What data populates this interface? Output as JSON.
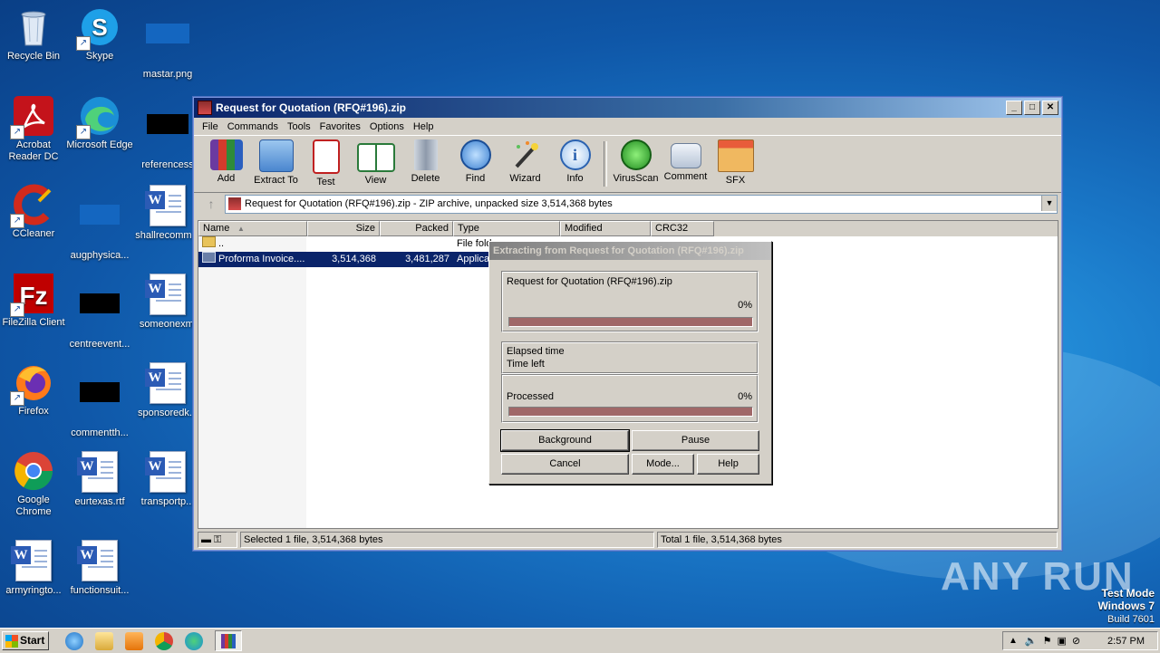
{
  "desktop": {
    "icons": [
      {
        "label": "Recycle Bin"
      },
      {
        "label": "Skype"
      },
      {
        "label": "mastar.png"
      },
      {
        "label": "Acrobat Reader DC"
      },
      {
        "label": "Microsoft Edge"
      },
      {
        "label": "referencess"
      },
      {
        "label": "CCleaner"
      },
      {
        "label": "augphysica..."
      },
      {
        "label": "shallrecomm..."
      },
      {
        "label": "FileZilla Client"
      },
      {
        "label": "centreevent..."
      },
      {
        "label": "someonexml"
      },
      {
        "label": "Firefox"
      },
      {
        "label": "commentth..."
      },
      {
        "label": "sponsoredk..."
      },
      {
        "label": "Google Chrome"
      },
      {
        "label": "eurtexas.rtf"
      },
      {
        "label": "transportp..."
      },
      {
        "label": "armyringto..."
      },
      {
        "label": "functionsuit..."
      }
    ]
  },
  "window": {
    "title": "Request for Quotation (RFQ#196).zip",
    "menu": [
      "File",
      "Commands",
      "Tools",
      "Favorites",
      "Options",
      "Help"
    ],
    "toolbar": [
      "Add",
      "Extract To",
      "Test",
      "View",
      "Delete",
      "Find",
      "Wizard",
      "Info",
      "VirusScan",
      "Comment",
      "SFX"
    ],
    "address": "Request for Quotation (RFQ#196).zip - ZIP archive, unpacked size 3,514,368 bytes",
    "columns": [
      "Name",
      "Size",
      "Packed",
      "Type",
      "Modified",
      "CRC32"
    ],
    "rows": [
      {
        "name": "..",
        "size": "",
        "packed": "",
        "type": "File fold"
      },
      {
        "name": "Proforma Invoice....",
        "size": "3,514,368",
        "packed": "3,481,287",
        "type": "Applicat"
      }
    ],
    "status_left": "Selected 1 file, 3,514,368 bytes",
    "status_right": "Total 1 file, 3,514,368 bytes"
  },
  "dialog": {
    "title": "Extracting from Request for Quotation (RFQ#196).zip",
    "archive": "Request for Quotation (RFQ#196).zip",
    "percent1": "0%",
    "elapsed_label": "Elapsed time",
    "timeleft_label": "Time left",
    "processed_label": "Processed",
    "percent2": "0%",
    "progress_current": 0,
    "progress_total": 0,
    "buttons": {
      "background": "Background",
      "pause": "Pause",
      "cancel": "Cancel",
      "mode": "Mode...",
      "help": "Help"
    }
  },
  "taskbar": {
    "start": "Start",
    "clock": "2:57 PM"
  },
  "watermark": {
    "brand": "ANY RUN",
    "mode": "Test Mode",
    "os": "Windows 7",
    "build": "Build 7601"
  }
}
